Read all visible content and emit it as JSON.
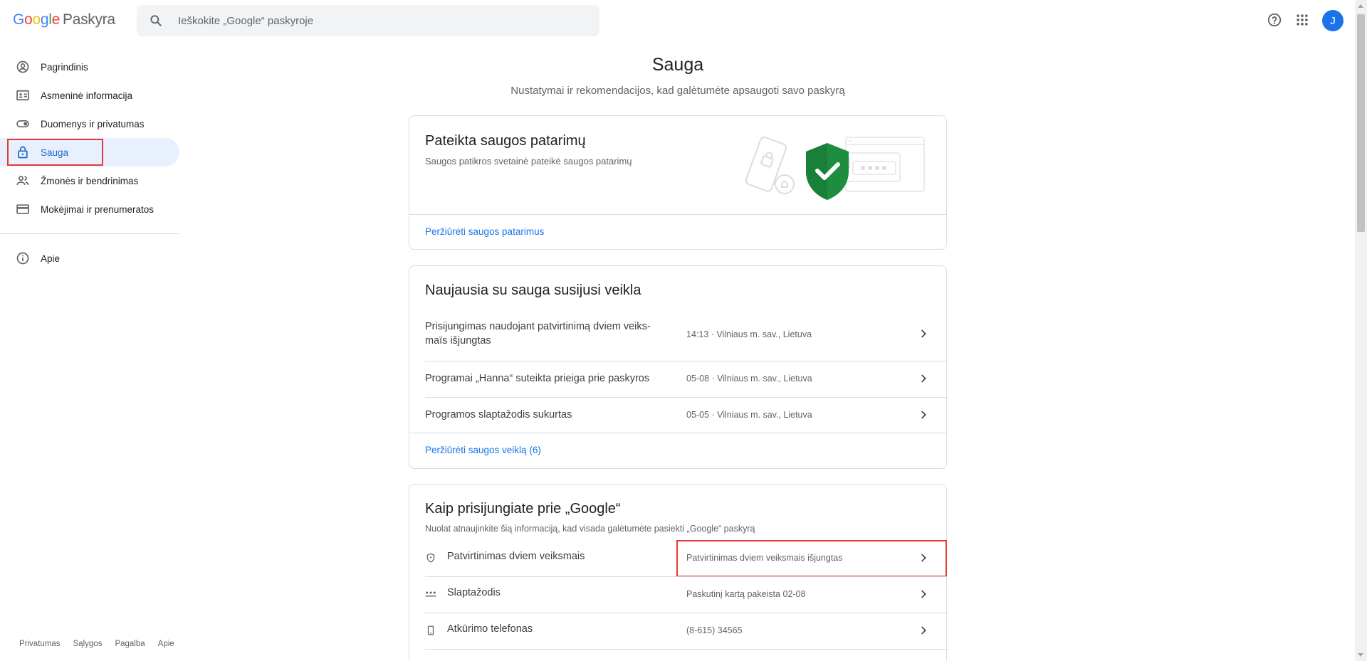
{
  "header": {
    "logo_letters": [
      "G",
      "o",
      "o",
      "g",
      "l",
      "e"
    ],
    "product": "Paskyra",
    "search_placeholder": "Ieškokite „Google“ paskyroje",
    "avatar_letter": "J",
    "icons": [
      "search-icon",
      "help-icon",
      "apps-grid-icon"
    ]
  },
  "sidebar": {
    "items": [
      {
        "label": "Pagrindinis",
        "icon": "account-circle-icon"
      },
      {
        "label": "Asmeninė informacija",
        "icon": "id-card-icon"
      },
      {
        "label": "Duomenys ir privatumas",
        "icon": "toggle-icon"
      },
      {
        "label": "Sauga",
        "icon": "lock-icon",
        "active": true
      },
      {
        "label": "Žmonės ir bendrinimas",
        "icon": "people-icon"
      },
      {
        "label": "Mokėjimai ir prenumeratos",
        "icon": "credit-card-icon"
      }
    ],
    "about": {
      "label": "Apie",
      "icon": "info-icon"
    },
    "footer": [
      "Privatumas",
      "Sąlygos",
      "Pagalba",
      "Apie"
    ]
  },
  "main": {
    "title": "Sauga",
    "subtitle": "Nustatymai ir rekomendacijos, kad galėtumėte apsaugoti savo paskyrą",
    "tips_card": {
      "title": "Pateikta saugos patarimų",
      "desc": "Saugos patikros svetainė pateikė saugos patarimų",
      "link": "Peržiūrėti saugos patarimus"
    },
    "activity_card": {
      "title": "Naujausia su sauga susijusi veikla",
      "rows": [
        {
          "label": "Prisijungimas naudojant patvirtinimą dviem veiks-maïs išjungtas",
          "value": "14:13 · Vilniaus m. sav., Lietuva"
        },
        {
          "label": "Programai „Hanna“ suteikta prieiga prie paskyros",
          "value": "05-08 · Vilniaus m. sav., Lietuva"
        },
        {
          "label": "Programos slaptažodis sukurtas",
          "value": "05-05 · Vilniaus m. sav., Lietuva"
        }
      ],
      "link": "Peržiūrėti saugos veiklą (6)"
    },
    "signin_card": {
      "title": "Kaip prisijungiate prie „Google“",
      "desc": "Nuolat atnaujinkite šią informaciją, kad visada galėtumėte pasiekti „Google“ paskyrą",
      "rows": [
        {
          "label": "Patvirtinimas dviem veiksmais",
          "value": "Patvirtinimas dviem veiksmais išjungtas",
          "icon": "shield-icon"
        },
        {
          "label": "Slaptažodis",
          "value": "Paskutinį kartą pakeista 02-08",
          "icon": "password-dots-icon"
        },
        {
          "label": "Atkūrimo telefonas",
          "value": "(8-615) 34565",
          "icon": "phone-icon"
        }
      ]
    }
  }
}
